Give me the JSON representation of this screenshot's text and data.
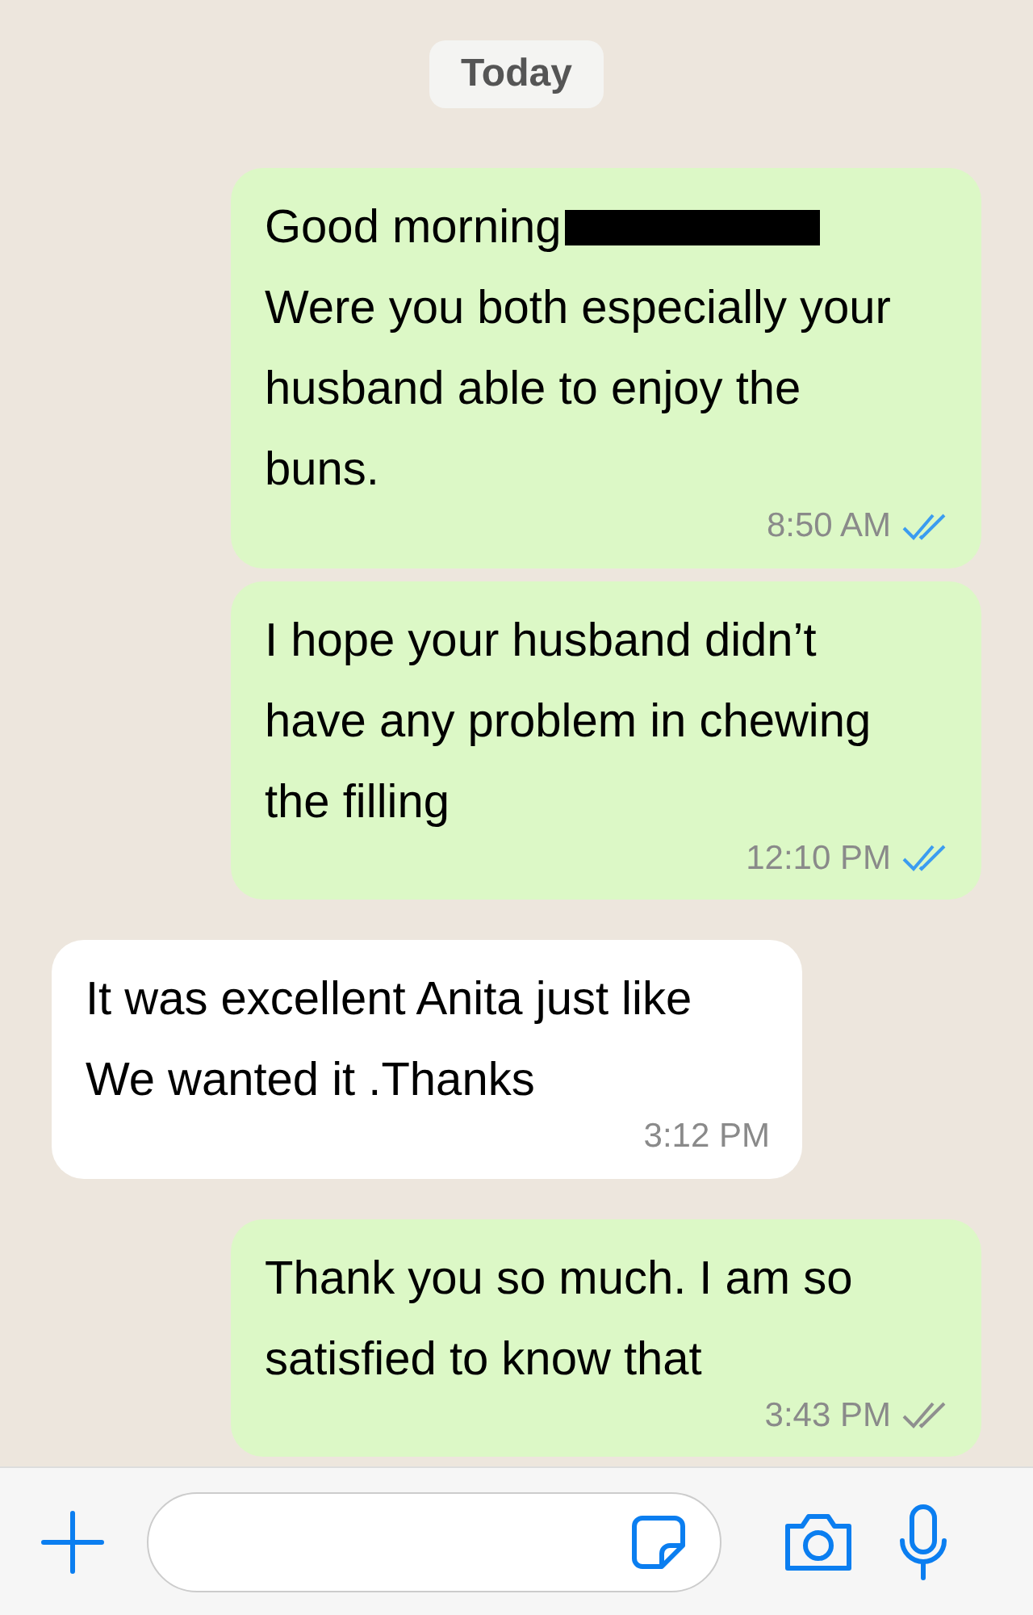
{
  "date_label": "Today",
  "messages": [
    {
      "kind": "outgoing",
      "text": "Good morning\nWere you both especially your husband able to enjoy the buns.",
      "redacted": true,
      "time": "8:50 AM",
      "read": true
    },
    {
      "kind": "outgoing",
      "text": "I hope your husband didn’t have any problem in chewing the filling",
      "time": "12:10 PM",
      "read": true
    },
    {
      "kind": "incoming",
      "text": "It was excellent Anita just like We wanted it .Thanks",
      "time": "3:12 PM"
    },
    {
      "kind": "outgoing",
      "text": "Thank you so much. I am so satisfied to know that",
      "time": "3:43 PM",
      "read": false
    }
  ]
}
